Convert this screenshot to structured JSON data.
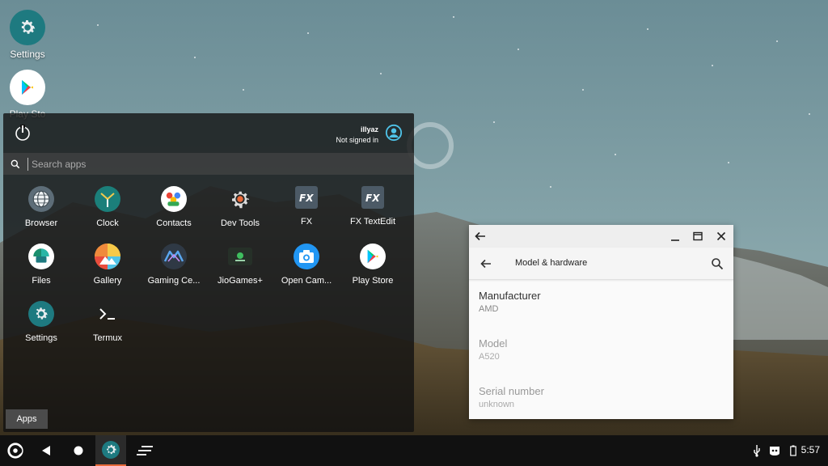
{
  "desktop": {
    "icons": [
      {
        "label": "Settings",
        "icon": "settings-gear-icon"
      },
      {
        "label": "Play Sto",
        "icon": "play-store-icon"
      }
    ]
  },
  "start_menu": {
    "user": {
      "name": "illyaz",
      "status": "Not signed in"
    },
    "search": {
      "placeholder": "Search apps"
    },
    "apps": [
      {
        "label": "Browser",
        "icon": "browser-globe-icon"
      },
      {
        "label": "Clock",
        "icon": "clock-icon"
      },
      {
        "label": "Contacts",
        "icon": "contacts-icon"
      },
      {
        "label": "Dev Tools",
        "icon": "dev-tools-gear-icon"
      },
      {
        "label": "FX",
        "icon": "fx-file-explorer-icon"
      },
      {
        "label": "FX TextEdit",
        "icon": "fx-textedit-icon"
      },
      {
        "label": "Files",
        "icon": "files-icon"
      },
      {
        "label": "Gallery",
        "icon": "gallery-icon"
      },
      {
        "label": "Gaming Ce...",
        "icon": "gaming-center-icon"
      },
      {
        "label": "JioGames+",
        "icon": "jiogames-icon"
      },
      {
        "label": "Open Cam...",
        "icon": "camera-icon"
      },
      {
        "label": "Play Store",
        "icon": "play-store-icon"
      },
      {
        "label": "Settings",
        "icon": "settings-gear-icon"
      },
      {
        "label": "Termux",
        "icon": "terminal-icon"
      }
    ],
    "apps_button": "Apps"
  },
  "settings_window": {
    "title": "Model & hardware",
    "items": [
      {
        "label": "Manufacturer",
        "value": "AMD"
      },
      {
        "label": "Model",
        "value": "A520"
      },
      {
        "label": "Serial number",
        "value": "unknown"
      }
    ]
  },
  "taskbar": {
    "clock": "5:57"
  },
  "colors": {
    "accent": "#e86a3a",
    "teal": "#1e7a80",
    "user_icon": "#4fc3e8"
  }
}
